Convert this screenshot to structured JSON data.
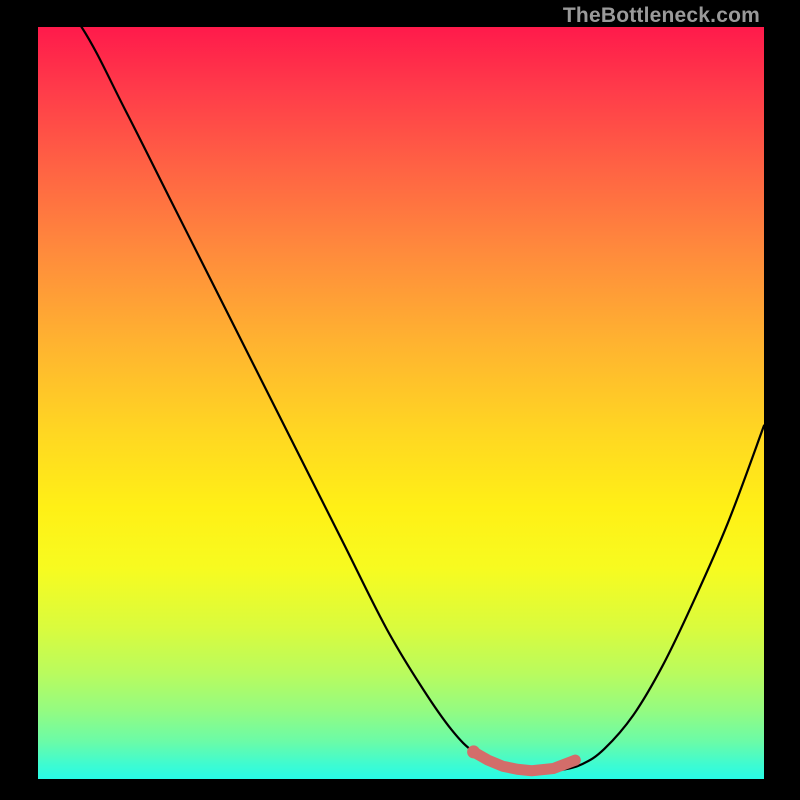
{
  "watermark": "TheBottleneck.com",
  "chart_data": {
    "type": "line",
    "title": "",
    "xlabel": "",
    "ylabel": "",
    "xlim": [
      0,
      100
    ],
    "ylim": [
      0,
      100
    ],
    "grid": false,
    "legend": false,
    "series": [
      {
        "name": "bottleneck-curve",
        "x": [
          0,
          6,
          12,
          18,
          24,
          30,
          36,
          42,
          48,
          53,
          57,
          60,
          63,
          66,
          69,
          72,
          75,
          78,
          82,
          86,
          90,
          95,
          100
        ],
        "y": [
          107,
          100,
          89,
          77.5,
          66,
          54.5,
          43,
          31.5,
          20,
          12,
          6.5,
          3.6,
          2.1,
          1.3,
          1.1,
          1.2,
          2.0,
          4.0,
          8.5,
          15,
          23,
          34,
          47
        ]
      },
      {
        "name": "highlight-points",
        "x": [
          60,
          62,
          64,
          66,
          68,
          71,
          74
        ],
        "y": [
          3.6,
          2.5,
          1.7,
          1.3,
          1.1,
          1.4,
          2.5
        ]
      }
    ],
    "colors": {
      "curve": "#000000",
      "highlight": "#d36d6a",
      "gradient_top": "#ff1a4b",
      "gradient_bottom": "#28fbe7"
    }
  }
}
